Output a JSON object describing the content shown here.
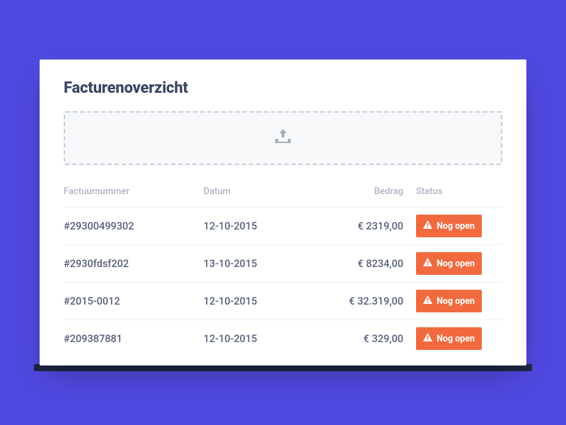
{
  "title": "Facturenoverzicht",
  "columns": {
    "nummer": "Factuurnummer",
    "datum": "Datum",
    "bedrag": "Bedrag",
    "status": "Status"
  },
  "status_label": "Nog open",
  "rows": [
    {
      "nummer": "#29300499302",
      "datum": "12-10-2015",
      "bedrag": "€ 2319,00"
    },
    {
      "nummer": "#2930fdsf202",
      "datum": "13-10-2015",
      "bedrag": "€ 8234,00"
    },
    {
      "nummer": "#2015-0012",
      "datum": "12-10-2015",
      "bedrag": "€ 32.319,00"
    },
    {
      "nummer": "#209387881",
      "datum": "12-10-2015",
      "bedrag": "€ 329,00"
    }
  ],
  "colors": {
    "bg": "#5049e0",
    "accent": "#f16a3f",
    "text": "#3a4463"
  }
}
